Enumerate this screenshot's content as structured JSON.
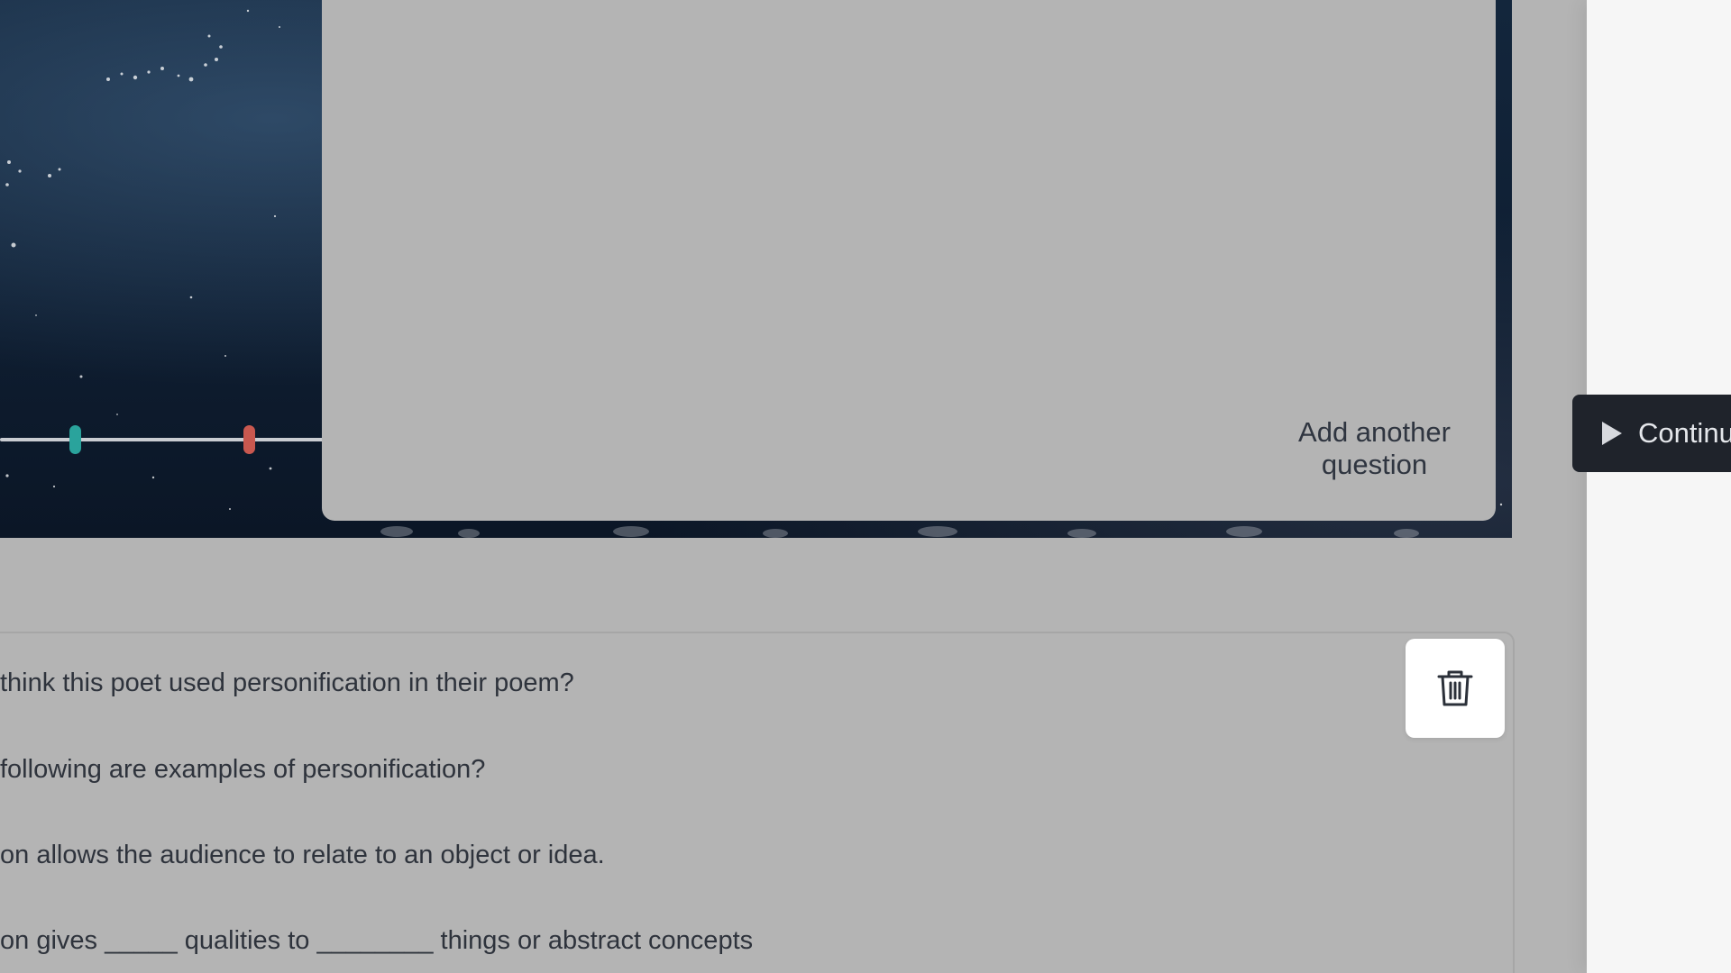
{
  "dialog": {
    "add_question_label": "Add another question",
    "continue_label": "Continue"
  },
  "questions": [
    "think this poet used personification in their poem?",
    " following are examples of personification?",
    "on allows the audience to relate to an object or idea.",
    "on gives _____ qualities to ________ things or abstract concepts"
  ],
  "icons": {
    "continue": "play-icon",
    "delete": "trash-icon"
  },
  "colors": {
    "overlay": "#b4b4b4",
    "continue_button": "#1f232b",
    "marker_teal": "#2aa39c",
    "marker_red": "#c9584f",
    "text": "#2e333c"
  }
}
